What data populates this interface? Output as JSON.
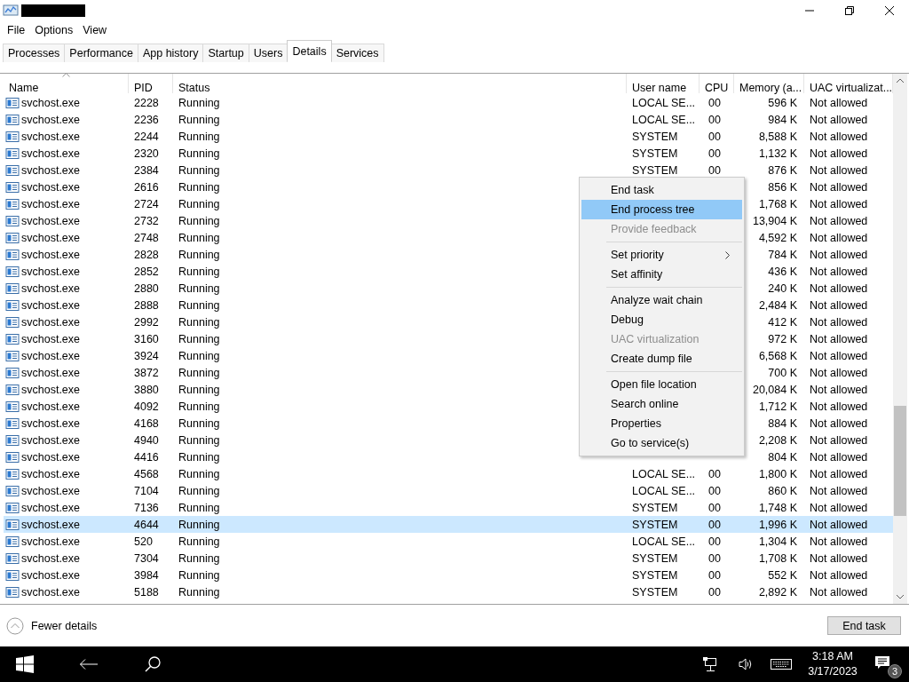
{
  "menu_bar": [
    {
      "label": "File"
    },
    {
      "label": "Options"
    },
    {
      "label": "View"
    }
  ],
  "tabs": [
    {
      "label": "Processes",
      "selected": false
    },
    {
      "label": "Performance",
      "selected": false
    },
    {
      "label": "App history",
      "selected": false
    },
    {
      "label": "Startup",
      "selected": false
    },
    {
      "label": "Users",
      "selected": false
    },
    {
      "label": "Details",
      "selected": true
    },
    {
      "label": "Services",
      "selected": false
    }
  ],
  "table": {
    "columns": [
      {
        "label": "Name",
        "sorted": true
      },
      {
        "label": "PID",
        "sorted": false
      },
      {
        "label": "Status",
        "sorted": false
      },
      {
        "label": "User name",
        "sorted": false
      },
      {
        "label": "CPU",
        "sorted": false
      },
      {
        "label": "Memory (a...",
        "sorted": false
      },
      {
        "label": "UAC virtualizat...",
        "sorted": false
      }
    ],
    "rows": [
      {
        "name": "svchost.exe",
        "pid": "2228",
        "status": "Running",
        "user": "LOCAL SE...",
        "cpu": "00",
        "memory": "596 K",
        "uac": "Not allowed",
        "selected": false
      },
      {
        "name": "svchost.exe",
        "pid": "2236",
        "status": "Running",
        "user": "LOCAL SE...",
        "cpu": "00",
        "memory": "984 K",
        "uac": "Not allowed",
        "selected": false
      },
      {
        "name": "svchost.exe",
        "pid": "2244",
        "status": "Running",
        "user": "SYSTEM",
        "cpu": "00",
        "memory": "8,588 K",
        "uac": "Not allowed",
        "selected": false
      },
      {
        "name": "svchost.exe",
        "pid": "2320",
        "status": "Running",
        "user": "SYSTEM",
        "cpu": "00",
        "memory": "1,132 K",
        "uac": "Not allowed",
        "selected": false
      },
      {
        "name": "svchost.exe",
        "pid": "2384",
        "status": "Running",
        "user": "SYSTEM",
        "cpu": "00",
        "memory": "876 K",
        "uac": "Not allowed",
        "selected": false
      },
      {
        "name": "svchost.exe",
        "pid": "2616",
        "status": "Running",
        "memory": "856 K",
        "uac": "Not allowed",
        "selected": false
      },
      {
        "name": "svchost.exe",
        "pid": "2724",
        "status": "Running",
        "memory": "1,768 K",
        "uac": "Not allowed",
        "selected": false
      },
      {
        "name": "svchost.exe",
        "pid": "2732",
        "status": "Running",
        "memory": "13,904 K",
        "uac": "Not allowed",
        "selected": false
      },
      {
        "name": "svchost.exe",
        "pid": "2748",
        "status": "Running",
        "memory": "4,592 K",
        "uac": "Not allowed",
        "selected": false
      },
      {
        "name": "svchost.exe",
        "pid": "2828",
        "status": "Running",
        "memory": "784 K",
        "uac": "Not allowed",
        "selected": false
      },
      {
        "name": "svchost.exe",
        "pid": "2852",
        "status": "Running",
        "memory": "436 K",
        "uac": "Not allowed",
        "selected": false
      },
      {
        "name": "svchost.exe",
        "pid": "2880",
        "status": "Running",
        "memory": "240 K",
        "uac": "Not allowed",
        "selected": false
      },
      {
        "name": "svchost.exe",
        "pid": "2888",
        "status": "Running",
        "memory": "2,484 K",
        "uac": "Not allowed",
        "selected": false
      },
      {
        "name": "svchost.exe",
        "pid": "2992",
        "status": "Running",
        "memory": "412 K",
        "uac": "Not allowed",
        "selected": false
      },
      {
        "name": "svchost.exe",
        "pid": "3160",
        "status": "Running",
        "memory": "972 K",
        "uac": "Not allowed",
        "selected": false
      },
      {
        "name": "svchost.exe",
        "pid": "3924",
        "status": "Running",
        "memory": "6,568 K",
        "uac": "Not allowed",
        "selected": false
      },
      {
        "name": "svchost.exe",
        "pid": "3872",
        "status": "Running",
        "memory": "700 K",
        "uac": "Not allowed",
        "selected": false
      },
      {
        "name": "svchost.exe",
        "pid": "3880",
        "status": "Running",
        "memory": "20,084 K",
        "uac": "Not allowed",
        "selected": false
      },
      {
        "name": "svchost.exe",
        "pid": "4092",
        "status": "Running",
        "memory": "1,712 K",
        "uac": "Not allowed",
        "selected": false
      },
      {
        "name": "svchost.exe",
        "pid": "4168",
        "status": "Running",
        "memory": "884 K",
        "uac": "Not allowed",
        "selected": false
      },
      {
        "name": "svchost.exe",
        "pid": "4940",
        "status": "Running",
        "memory": "2,208 K",
        "uac": "Not allowed",
        "selected": false
      },
      {
        "name": "svchost.exe",
        "pid": "4416",
        "status": "Running",
        "memory": "804 K",
        "uac": "Not allowed",
        "selected": false
      },
      {
        "name": "svchost.exe",
        "pid": "4568",
        "status": "Running",
        "user": "LOCAL SE...",
        "cpu": "00",
        "memory": "1,800 K",
        "uac": "Not allowed",
        "selected": false
      },
      {
        "name": "svchost.exe",
        "pid": "7104",
        "status": "Running",
        "user": "LOCAL SE...",
        "cpu": "00",
        "memory": "860 K",
        "uac": "Not allowed",
        "selected": false
      },
      {
        "name": "svchost.exe",
        "pid": "7136",
        "status": "Running",
        "user": "SYSTEM",
        "cpu": "00",
        "memory": "1,748 K",
        "uac": "Not allowed",
        "selected": false
      },
      {
        "name": "svchost.exe",
        "pid": "4644",
        "status": "Running",
        "user": "SYSTEM",
        "cpu": "00",
        "memory": "1,996 K",
        "uac": "Not allowed",
        "selected": true
      },
      {
        "name": "svchost.exe",
        "pid": "520",
        "status": "Running",
        "user": "LOCAL SE...",
        "cpu": "00",
        "memory": "1,304 K",
        "uac": "Not allowed",
        "selected": false
      },
      {
        "name": "svchost.exe",
        "pid": "7304",
        "status": "Running",
        "user": "SYSTEM",
        "cpu": "00",
        "memory": "1,708 K",
        "uac": "Not allowed",
        "selected": false
      },
      {
        "name": "svchost.exe",
        "pid": "3984",
        "status": "Running",
        "user": "SYSTEM",
        "cpu": "00",
        "memory": "552 K",
        "uac": "Not allowed",
        "selected": false
      },
      {
        "name": "svchost.exe",
        "pid": "5188",
        "status": "Running",
        "user": "SYSTEM",
        "cpu": "00",
        "memory": "2,892 K",
        "uac": "Not allowed",
        "selected": false
      }
    ]
  },
  "context_menu": {
    "items": [
      {
        "kind": "item",
        "label": "End task",
        "disabled": false,
        "selected": false,
        "submenu": false
      },
      {
        "kind": "item",
        "label": "End process tree",
        "disabled": false,
        "selected": true,
        "submenu": false
      },
      {
        "kind": "item",
        "label": "Provide feedback",
        "disabled": true,
        "selected": false,
        "submenu": false
      },
      {
        "kind": "separator"
      },
      {
        "kind": "item",
        "label": "Set priority",
        "disabled": false,
        "selected": false,
        "submenu": true
      },
      {
        "kind": "item",
        "label": "Set affinity",
        "disabled": false,
        "selected": false,
        "submenu": false
      },
      {
        "kind": "separator"
      },
      {
        "kind": "item",
        "label": "Analyze wait chain",
        "disabled": false,
        "selected": false,
        "submenu": false
      },
      {
        "kind": "item",
        "label": "Debug",
        "disabled": false,
        "selected": false,
        "submenu": false
      },
      {
        "kind": "item",
        "label": "UAC virtualization",
        "disabled": true,
        "selected": false,
        "submenu": false
      },
      {
        "kind": "item",
        "label": "Create dump file",
        "disabled": false,
        "selected": false,
        "submenu": false
      },
      {
        "kind": "separator"
      },
      {
        "kind": "item",
        "label": "Open file location",
        "disabled": false,
        "selected": false,
        "submenu": false
      },
      {
        "kind": "item",
        "label": "Search online",
        "disabled": false,
        "selected": false,
        "submenu": false
      },
      {
        "kind": "item",
        "label": "Properties",
        "disabled": false,
        "selected": false,
        "submenu": false
      },
      {
        "kind": "item",
        "label": "Go to service(s)",
        "disabled": false,
        "selected": false,
        "submenu": false
      }
    ]
  },
  "footer": {
    "details_toggle": "Fewer details",
    "end_task_button": "End task"
  },
  "taskbar": {
    "time": "3:18 AM",
    "date": "3/17/2023",
    "notification_count": "3"
  }
}
